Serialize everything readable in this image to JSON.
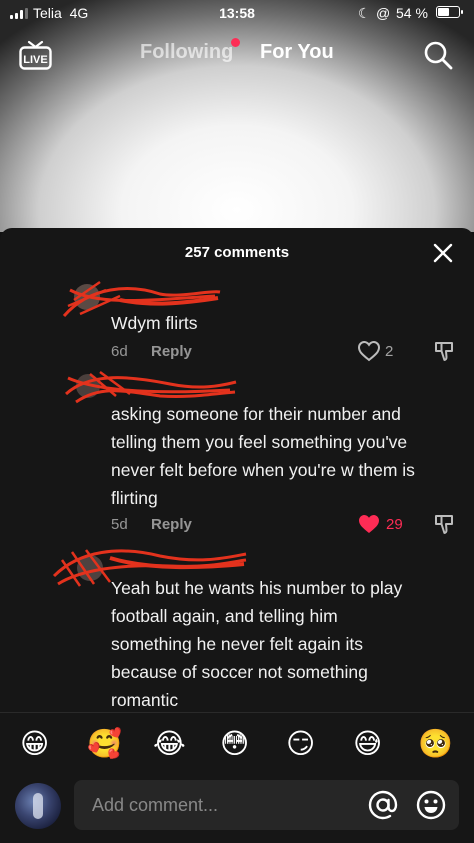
{
  "status_bar": {
    "carrier": "Telia",
    "network": "4G",
    "time": "13:58",
    "battery_percent": "54 %"
  },
  "top_nav": {
    "live_label": "LIVE",
    "tab_following": "Following",
    "tab_for_you": "For You"
  },
  "comments_panel": {
    "title": "257 comments",
    "comments": [
      {
        "text_lines": [
          "Wdym flirts"
        ],
        "age": "6d",
        "reply_label": "Reply",
        "likes": "2",
        "liked": false
      },
      {
        "text_lines": [
          "asking someone for their number and",
          "telling them you feel something you've",
          "never felt before when you're w them is",
          "flirting"
        ],
        "age": "5d",
        "reply_label": "Reply",
        "likes": "29",
        "liked": true
      },
      {
        "text_lines": [
          "Yeah but he wants his number to play",
          "football again, and telling him",
          "something he never felt again its",
          "because of soccer not something",
          "romantic"
        ]
      }
    ]
  },
  "emoji_bar": [
    "😁",
    "🥰",
    "😂",
    "😳",
    "😏",
    "😅",
    "🥺"
  ],
  "composer": {
    "placeholder": "Add comment..."
  },
  "colors": {
    "accent_red": "#fe2c55",
    "panel_bg": "#161616",
    "input_bg": "#262626"
  },
  "icons": [
    "live-icon",
    "search-icon",
    "close-icon",
    "heart-icon",
    "dislike-icon",
    "at-icon",
    "emoji-icon"
  ]
}
